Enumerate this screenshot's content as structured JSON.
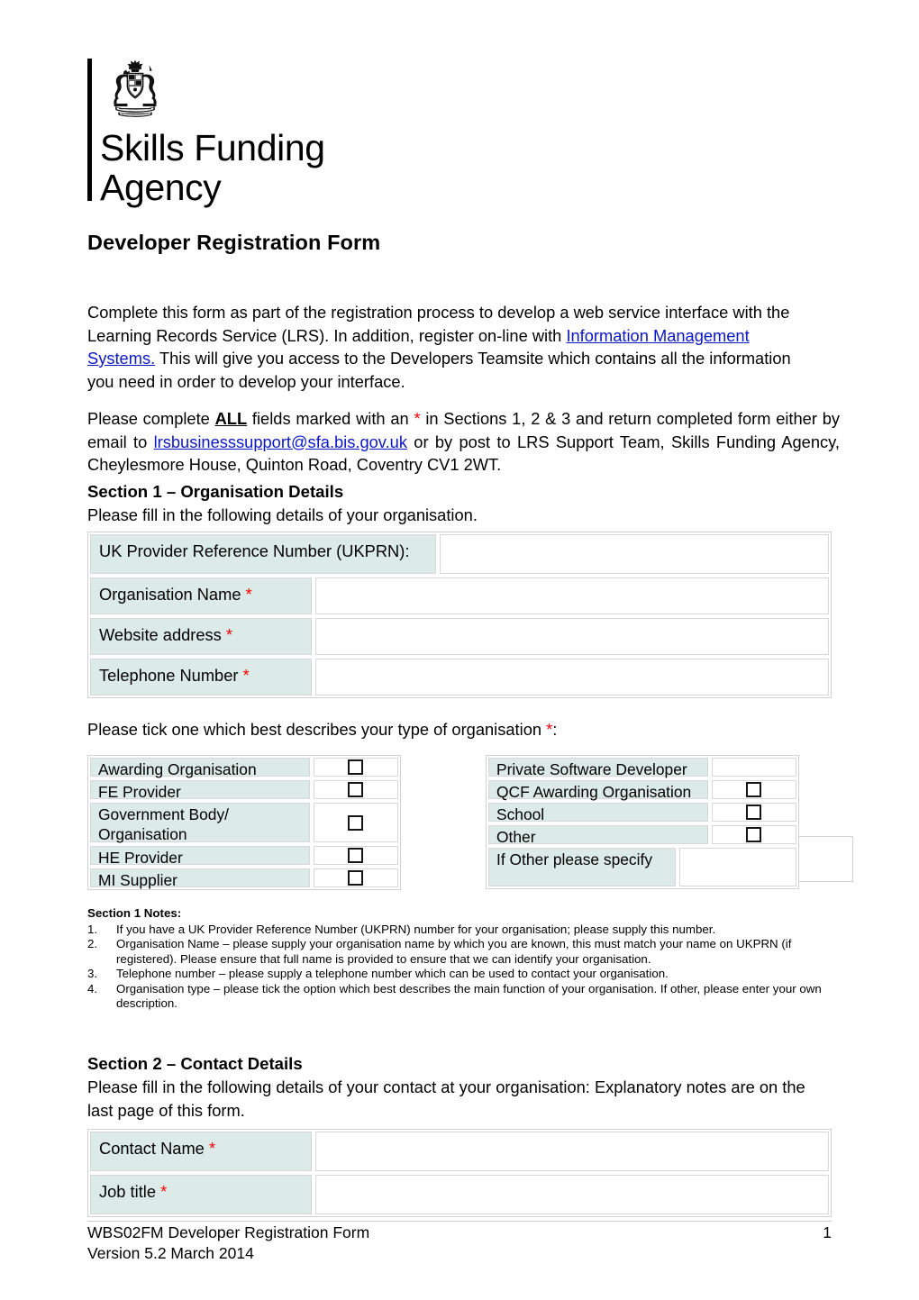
{
  "logo": {
    "crest_name": "royal-coat-of-arms",
    "title": "Skills Funding\nAgency"
  },
  "document": {
    "title": "Developer Registration Form"
  },
  "intro": {
    "part1": "Complete this form as part of the registration process to develop a web service interface with the Learning Records Service (LRS).  In addition, register on-line with ",
    "link_text": "Information Management Systems.",
    "part2": "  This will give you access to the Developers Teamsite which contains all the information you need in order to develop your interface."
  },
  "complete_notice": {
    "part1": "Please complete ",
    "all_bold": "ALL",
    "part2": " fields marked with an ",
    "asterisk": "*",
    "part3": " in Sections 1, 2 & 3 and return completed form either by email to ",
    "email_link": "lrsbusinesssupport@sfa.bis.gov.uk",
    "part4": " or by post to LRS Support Team, Skills Funding Agency,  Cheylesmore House, Quinton Road, Coventry  CV1 2WT."
  },
  "section1": {
    "heading": "Section 1 – Organisation Details",
    "subtitle": "Please fill in the following details of your organisation.",
    "fields": [
      {
        "label": "UK Provider Reference Number (UKPRN):",
        "required": false,
        "value": ""
      },
      {
        "label": "Organisation Name",
        "required": true,
        "value": ""
      },
      {
        "label": "Website address",
        "required": true,
        "value": ""
      },
      {
        "label": "Telephone Number",
        "required": true,
        "value": ""
      }
    ],
    "tick_prompt_before": "Please tick one which best describes your type of organisation ",
    "tick_prompt_asterisk": "*",
    "tick_prompt_after": ":",
    "tick_left": [
      {
        "label": "Awarding Organisation",
        "has_checkbox": true,
        "checked": false
      },
      {
        "label": "FE Provider",
        "has_checkbox": true,
        "checked": false
      },
      {
        "label": "Government Body/ Organisation",
        "has_checkbox": true,
        "checked": false
      },
      {
        "label": "HE Provider",
        "has_checkbox": true,
        "checked": false
      },
      {
        "label": "MI Supplier",
        "has_checkbox": true,
        "checked": false
      }
    ],
    "tick_right": [
      {
        "label": "Private Software Developer",
        "has_checkbox": false,
        "checked": false
      },
      {
        "label": "QCF Awarding Organisation",
        "has_checkbox": true,
        "checked": false
      },
      {
        "label": "School",
        "has_checkbox": true,
        "checked": false
      },
      {
        "label": "Other",
        "has_checkbox": true,
        "checked": false
      }
    ],
    "other_specify": {
      "label": "If Other please specify",
      "value": ""
    },
    "notes_title": "Section 1 Notes:",
    "notes": [
      {
        "num": "1.",
        "text": "If you have a UK Provider Reference Number (UKPRN) number for your organisation; please supply this number."
      },
      {
        "num": "2.",
        "text": "Organisation Name – please supply your organisation name by which you are known, this must match your name on UKPRN (if registered). Please ensure that full name is provided to ensure that we can identify your organisation."
      },
      {
        "num": "3.",
        "text": "Telephone number – please supply a telephone number which can be used to contact your organisation."
      },
      {
        "num": "4.",
        "text": "Organisation type – please tick the option which best describes the main function of your organisation. If other, please enter your own description."
      }
    ]
  },
  "section2": {
    "heading": "Section 2 – Contact Details",
    "subtitle": "Please fill in the following details of your contact at your organisation: Explanatory notes are on the last page of this form.",
    "fields": [
      {
        "label": "Contact Name",
        "required": true,
        "value": ""
      },
      {
        "label": "Job title",
        "required": true,
        "value": ""
      }
    ]
  },
  "footer": {
    "doc_ref": "WBS02FM Developer Registration Form",
    "page_number": "1",
    "version": "Version 5.2 March 2014"
  },
  "colors": {
    "label_bg": "#dcebe7",
    "link": "#0b17c4",
    "required_asterisk": "#ff0000",
    "table_border": "#d2d2d2",
    "cell_border": "#d8d8d8"
  }
}
